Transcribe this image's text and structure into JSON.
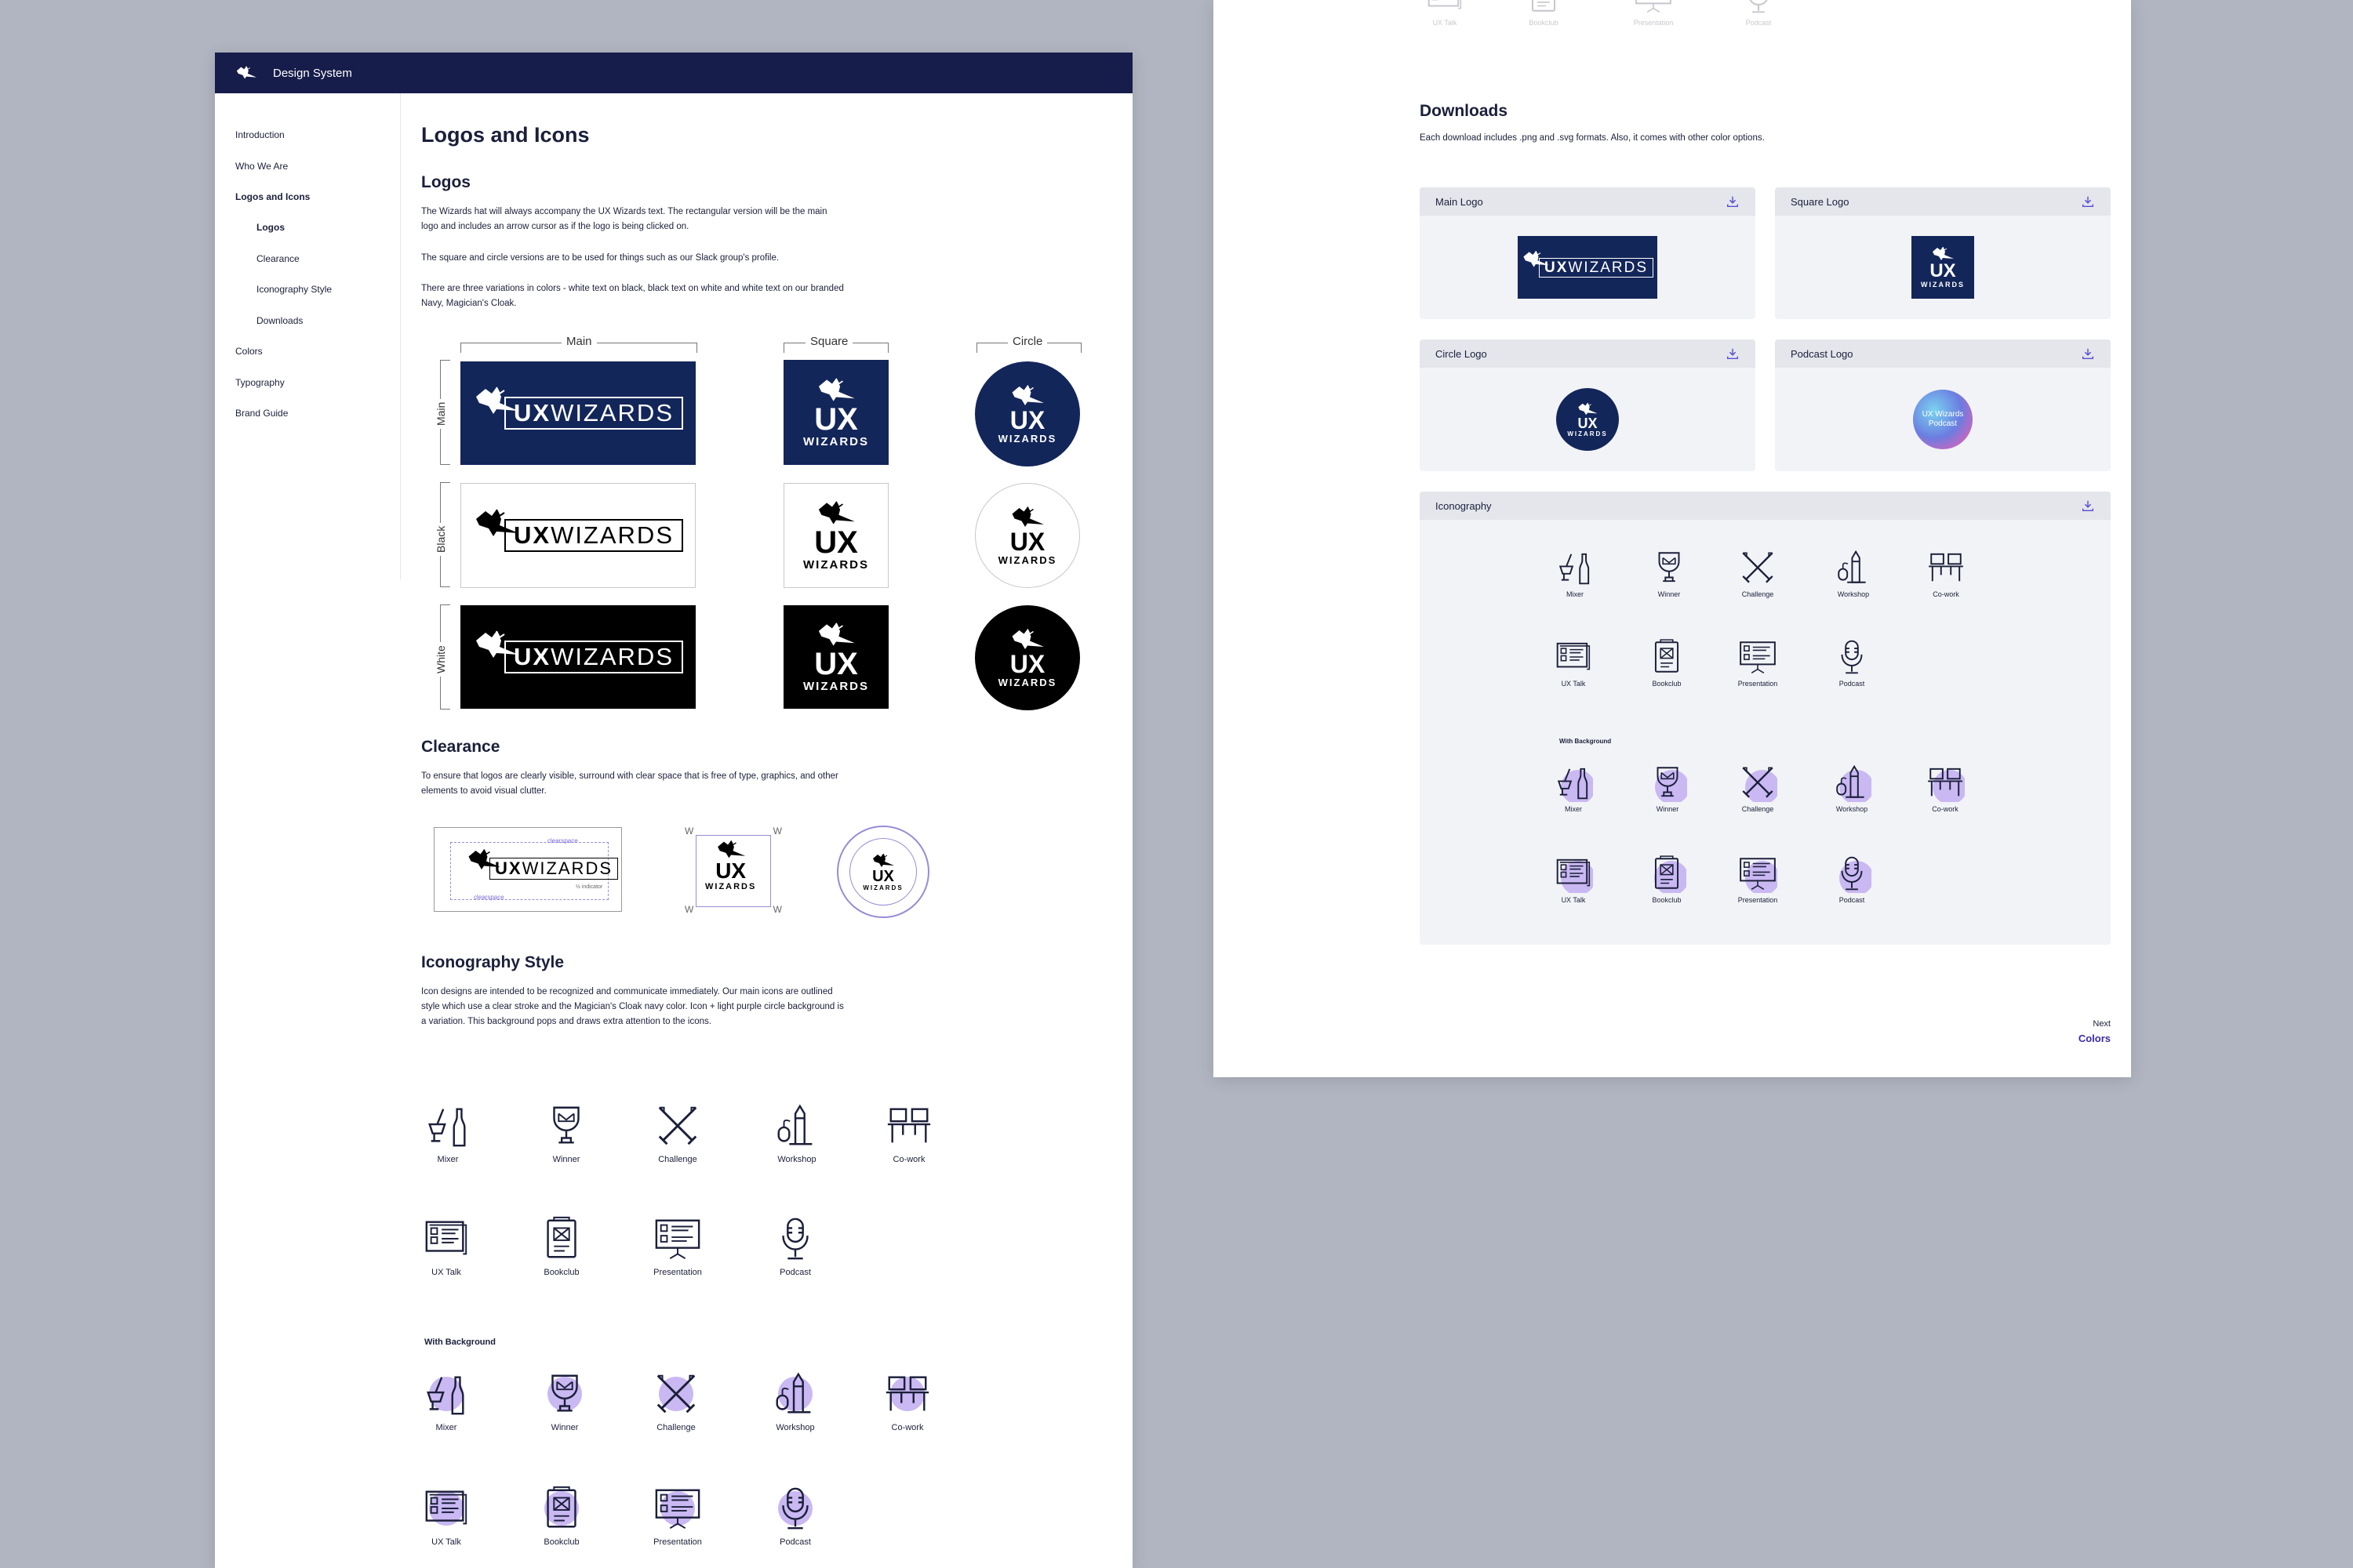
{
  "header": {
    "title": "Design System"
  },
  "sidebar": {
    "items": [
      {
        "label": "Introduction"
      },
      {
        "label": "Who We Are"
      },
      {
        "label": "Logos and Icons"
      },
      {
        "label": "Logos"
      },
      {
        "label": "Clearance"
      },
      {
        "label": "Iconography Style"
      },
      {
        "label": "Downloads"
      },
      {
        "label": "Colors"
      },
      {
        "label": "Typography"
      },
      {
        "label": "Brand Guide"
      }
    ]
  },
  "main": {
    "page_title": "Logos and Icons",
    "logos": {
      "heading": "Logos",
      "p1": "The Wizards hat will always accompany the UX Wizards text. The rectangular version will be the main logo and includes an arrow cursor as if the logo is being clicked on.",
      "p2": "The square and circle versions are to be used for things such as our Slack group's profile.",
      "p3": "There are three variations in colors - white text on black, black text on white and white text on our branded Navy, Magician's Cloak.",
      "col_labels": [
        "Main",
        "Square",
        "Circle"
      ],
      "row_labels": [
        "Main",
        "Black",
        "White"
      ],
      "wordmark_ux": "UX",
      "wordmark_rest": "WIZARDS",
      "square_ux": "UX",
      "square_wizards": "WIZARDS"
    },
    "clearance": {
      "heading": "Clearance",
      "p": "To ensure that logos are clearly visible, surround with clear space that is free of type, graphics, and other elements to avoid visual clutter.",
      "clearspace_label": "clearspace",
      "w_label": "W",
      "half_label": "½ indicator"
    },
    "iconography": {
      "heading": "Iconography Style",
      "p": "Icon designs are intended to be recognized and communicate immediately. Our main icons are outlined style which use a clear stroke and the Magician's Cloak navy color. Icon + light purple circle background is a variation. This background pops and draws extra attention to the icons.",
      "icons_row1": [
        "Mixer",
        "Winner",
        "Challenge",
        "Workshop",
        "Co-work"
      ],
      "icons_row2": [
        "UX Talk",
        "Bookclub",
        "Presentation",
        "Podcast"
      ],
      "with_background": "With Background"
    }
  },
  "downloads": {
    "heading": "Downloads",
    "p": "Each download includes .png and .svg formats. Also, it comes with other color options.",
    "cards": {
      "main_logo": "Main Logo",
      "square_logo": "Square Logo",
      "circle_logo": "Circle Logo",
      "podcast_logo": "Podcast Logo",
      "iconography": "Iconography"
    },
    "podcast_text": "UX Wizards Podcast",
    "next_label": "Next",
    "next_link": "Colors"
  },
  "colors": {
    "navy": "#13265a",
    "header": "#161d4a",
    "purple_bg": "#c9b8f2",
    "accent": "#3a2ba8"
  }
}
